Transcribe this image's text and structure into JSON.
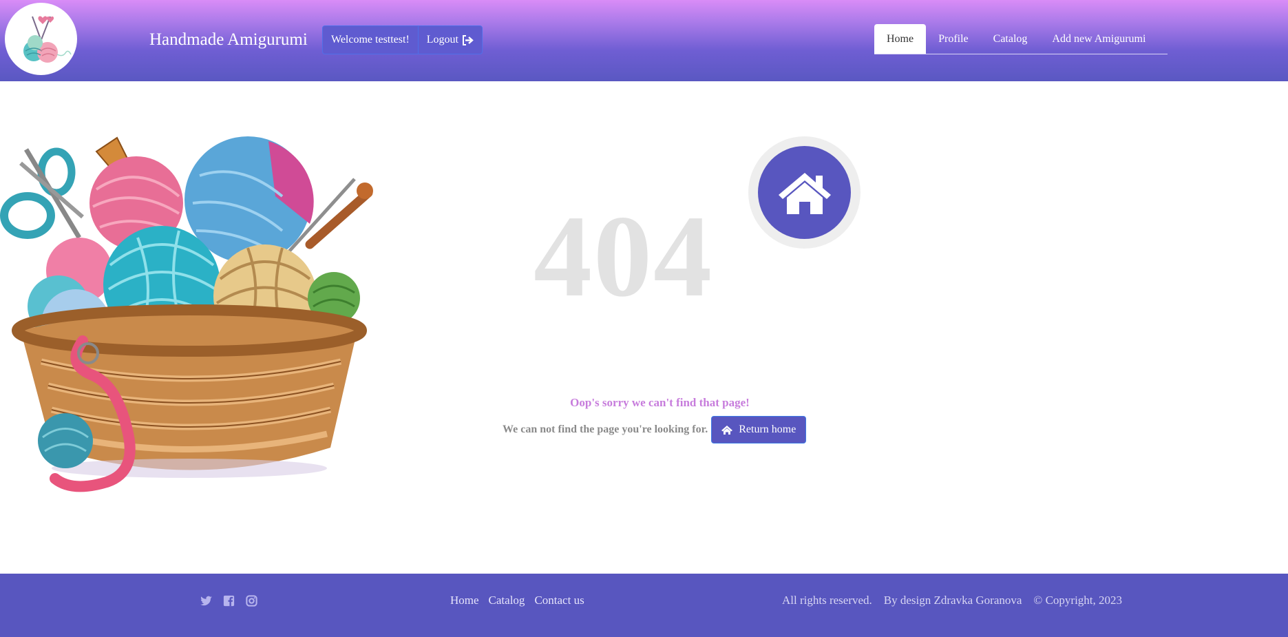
{
  "header": {
    "brand": "Handmade Amigurumi",
    "welcome": "Welcome testtest!",
    "logout": "Logout",
    "logo_icon": "yarn-balls-logo",
    "nav": [
      {
        "label": "Home",
        "active": true
      },
      {
        "label": "Profile",
        "active": false
      },
      {
        "label": "Catalog",
        "active": false
      },
      {
        "label": "Add new Amigurumi",
        "active": false
      }
    ]
  },
  "main": {
    "code": "404",
    "sorry": "Oop's sorry we can't find that page!",
    "message": "We can not find the page you're looking for.",
    "return_button": "Return home",
    "illustration": "yarn-basket-illustration",
    "badge_icon": "home-icon"
  },
  "footer": {
    "socials": [
      "twitter-icon",
      "facebook-icon",
      "instagram-icon"
    ],
    "links": [
      "Home",
      "Catalog",
      "Contact us"
    ],
    "rights": "All rights reserved.",
    "design": "By design Zdravka Goranova",
    "copyright": "© Copyright, 2023"
  },
  "colors": {
    "header_top": "#d98cf7",
    "header_bottom": "#5a58c2",
    "primary": "#5856bf",
    "accent_text": "#c77cdc",
    "code_gray": "#e2e2e2"
  }
}
